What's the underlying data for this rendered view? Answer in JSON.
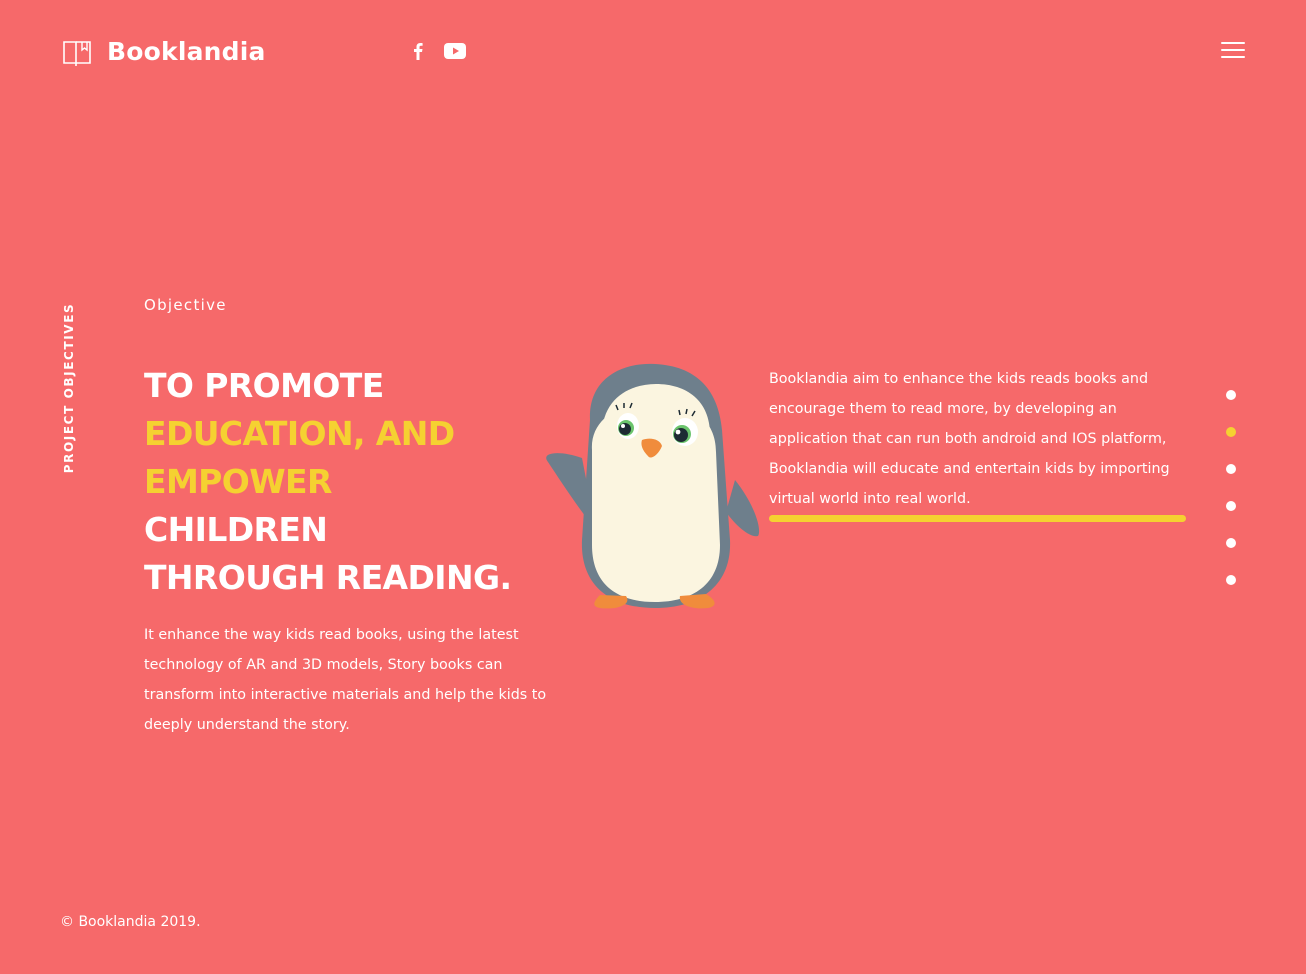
{
  "header": {
    "brand": "Booklandia",
    "social": [
      {
        "name": "facebook",
        "icon": "facebook-icon"
      },
      {
        "name": "youtube",
        "icon": "youtube-icon"
      }
    ],
    "menu_icon": "hamburger-menu-icon"
  },
  "section": {
    "vertical_label": "PROJECT OBJECTIVES",
    "eyebrow": "Objective",
    "headline": {
      "line1": "TO PROMOTE",
      "highlight1": "EDUCATION, AND",
      "highlight2": "EMPOWER",
      "line3_rest": "CHILDREN",
      "line4": "THROUGH READING."
    },
    "left_paragraph": "It enhance the way kids read books, using the latest technology of AR and 3D models, Story books can transform into interactive materials and help the kids to deeply understand the story.",
    "right_paragraph": "Booklandia aim to enhance the kids reads books and encourage them to read more, by developing an application that can run both android and IOS platform, Booklandia will educate and entertain kids by importing virtual world into real world.",
    "illustration": "penguin-illustration"
  },
  "pagination": {
    "count": 6,
    "active_index": 1
  },
  "footer": {
    "copyright": "© Booklandia 2019."
  },
  "colors": {
    "background": "#f6696a",
    "accent": "#f5d131",
    "text": "#ffffff"
  }
}
